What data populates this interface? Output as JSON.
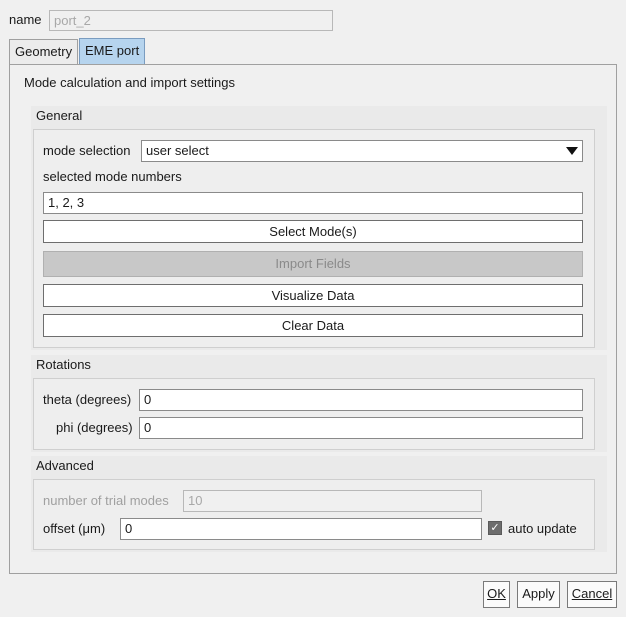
{
  "header": {
    "name_label": "name",
    "name_value": "port_2"
  },
  "tabs": [
    {
      "label": "Geometry",
      "active": false
    },
    {
      "label": "EME port",
      "active": true
    }
  ],
  "panel": {
    "title": "Mode calculation and import settings"
  },
  "general": {
    "title": "General",
    "mode_selection_label": "mode selection",
    "mode_selection_value": "user select",
    "selected_modes_label": "selected mode numbers",
    "selected_modes_value": "1, 2, 3",
    "select_modes_button": "Select Mode(s)",
    "import_fields_button": "Import Fields",
    "visualize_data_button": "Visualize Data",
    "clear_data_button": "Clear Data"
  },
  "rotations": {
    "title": "Rotations",
    "theta_label": "theta (degrees)",
    "theta_value": "0",
    "phi_label": "phi (degrees)",
    "phi_value": "0"
  },
  "advanced": {
    "title": "Advanced",
    "trial_modes_label": "number of trial modes",
    "trial_modes_value": "10",
    "offset_label": "offset (μm)",
    "offset_value": "0",
    "auto_update_label": "auto update",
    "auto_update_checked": true
  },
  "footer": {
    "ok": "OK",
    "apply": "Apply",
    "cancel": "Cancel"
  }
}
